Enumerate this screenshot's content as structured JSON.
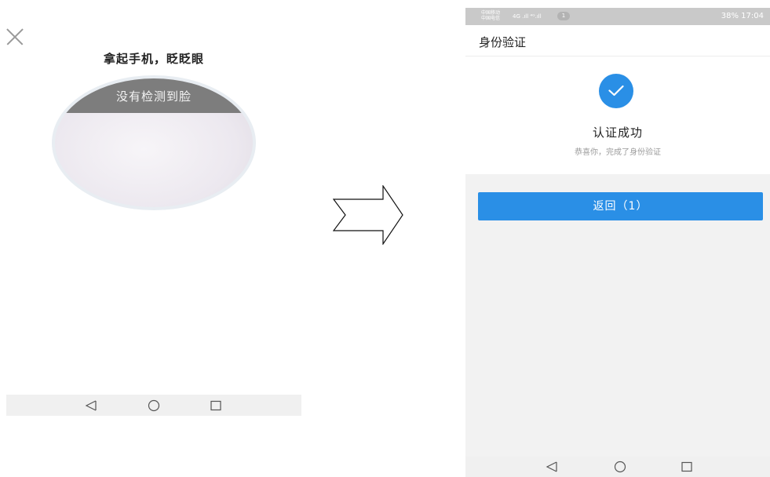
{
  "left_phone": {
    "title": "拿起手机，眨眨眼",
    "face_message": "没有检测到脸",
    "nav": {
      "back_icon": "triangle-back-icon",
      "home_icon": "circle-home-icon",
      "recent_icon": "square-recent-icon"
    }
  },
  "arrow_icon": "right-arrow-icon",
  "right_phone": {
    "status_bar": {
      "carrier_1": "中国移动",
      "carrier_2": "中国电信",
      "signal": "4G .ıll ⁴ᴳ.ıll",
      "speed": "0 K/s",
      "badge": "1",
      "right_text": "38%  17:04"
    },
    "header_title": "身份验证",
    "success_title": "认证成功",
    "success_subtitle": "恭喜你，完成了身份验证",
    "return_button": "返回（1）",
    "accent_color": "#2a8fe6",
    "nav": {
      "back_icon": "triangle-back-icon",
      "home_icon": "circle-home-icon",
      "recent_icon": "square-recent-icon"
    }
  }
}
